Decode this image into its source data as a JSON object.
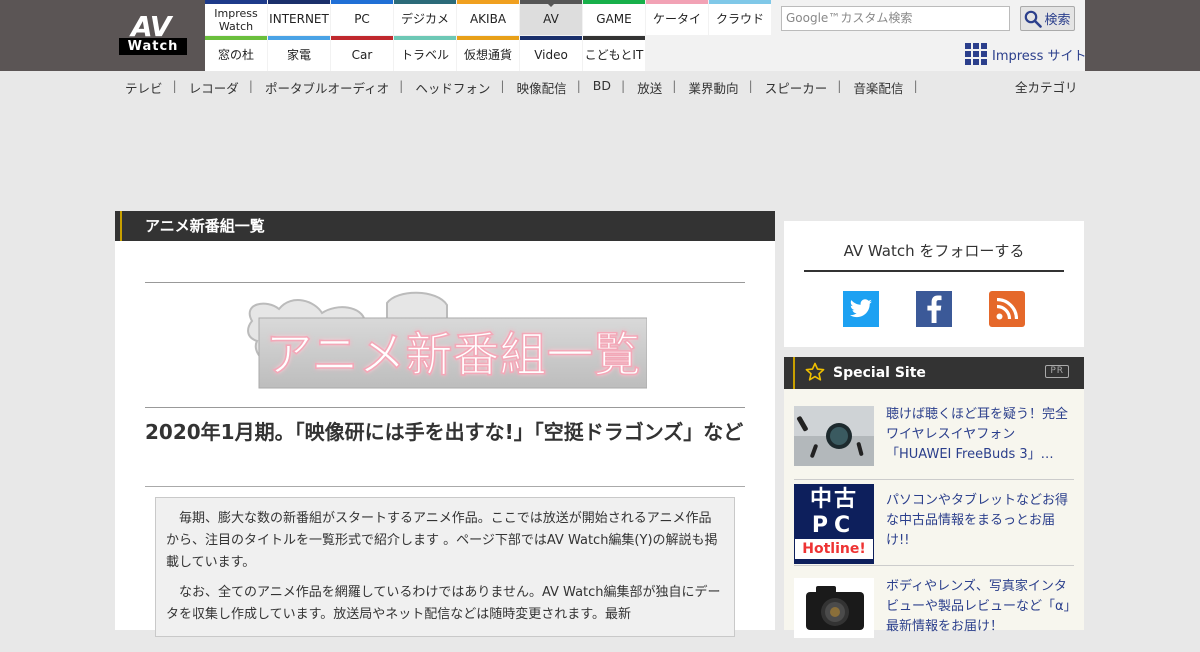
{
  "header": {
    "logo_top": "AV",
    "logo_bottom": "Watch",
    "sites": [
      {
        "label": "Impress Watch",
        "color": "#1d3a8a",
        "active": false
      },
      {
        "label": "INTERNET",
        "color": "#1a2f6b",
        "active": false
      },
      {
        "label": "PC",
        "color": "#1f6fd6",
        "active": false
      },
      {
        "label": "デジカメ",
        "color": "#2b6b79",
        "active": false
      },
      {
        "label": "AKIBA",
        "color": "#f0a020",
        "active": false
      },
      {
        "label": "AV",
        "color": "#555555",
        "active": true
      },
      {
        "label": "GAME",
        "color": "#18b04a",
        "active": false
      },
      {
        "label": "ケータイ",
        "color": "#f2a2b5",
        "active": false
      },
      {
        "label": "クラウド",
        "color": "#7fc8e8",
        "active": false
      },
      {
        "label": "窓の杜",
        "color": "#6abf3c",
        "active": false
      },
      {
        "label": "家電",
        "color": "#4aa3e6",
        "active": false
      },
      {
        "label": "Car",
        "color": "#c0282d",
        "active": false
      },
      {
        "label": "トラベル",
        "color": "#6dc8b5",
        "active": false
      },
      {
        "label": "仮想通貨",
        "color": "#e8a018",
        "active": false
      },
      {
        "label": "Video",
        "color": "#1a2f6b",
        "active": false
      },
      {
        "label": "こどもとIT",
        "color": "#333333",
        "active": false
      }
    ],
    "search_placeholder": "Google™カスタム検索",
    "search_button": "検索",
    "impress_site_label": "Impress サイト"
  },
  "catnav": {
    "items": [
      "テレビ",
      "レコーダ",
      "ポータブルオーディオ",
      "ヘッドフォン",
      "映像配信",
      "BD",
      "放送",
      "業界動向",
      "スピーカー",
      "音楽配信"
    ],
    "separator": "|",
    "all_categories": "全カテゴリ"
  },
  "main": {
    "section_title": "アニメ新番組一覧",
    "banner_text": "アニメ新番組一覧",
    "article_title": "2020年1月期。「映像研には手を出すな!」「空挺ドラゴンズ」など",
    "lead_paragraphs": [
      "毎期、膨大な数の新番組がスタートするアニメ作品。ここでは放送が開始されるアニメ作品から、注目のタイトルを一覧形式で紹介します 。ページ下部ではAV Watch編集(Y)の解説も掲載しています。",
      "なお、全てのアニメ作品を網羅しているわけではありません。AV Watch編集部が独自にデータを収集し作成しています。放送局やネット配信などは随時変更されます。最新"
    ]
  },
  "sidebar": {
    "follow_title": "AV Watch をフォローする",
    "sns": [
      {
        "name": "twitter",
        "color": "#1da1f2"
      },
      {
        "name": "facebook",
        "color": "#3b5998"
      },
      {
        "name": "rss",
        "color": "#e5682a"
      }
    ],
    "special": {
      "title": "Special Site",
      "pr_label": "PR",
      "items": [
        {
          "text": "聴けば聴くほど耳を疑う！完全ワイヤレスイヤフォン「HUAWEI FreeBuds 3」…"
        },
        {
          "text": "パソコンやタブレットなどお得な中古品情報をまるっとお届け!!",
          "thumb_lines": [
            "中古",
            "PC",
            "Hotline!"
          ]
        },
        {
          "text": "ボディやレンズ、写真家インタビューや製品レビューなど「α」最新情報をお届け！"
        }
      ]
    }
  }
}
